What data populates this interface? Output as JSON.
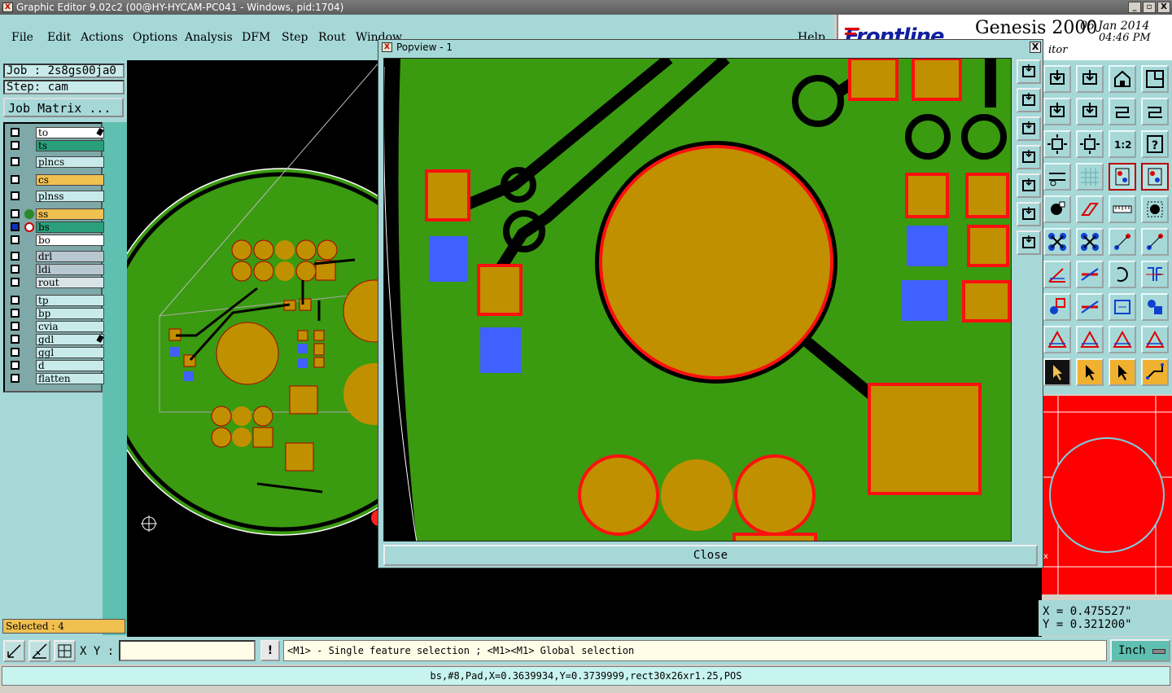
{
  "window": {
    "title": "Graphic Editor 9.02c2 (00@HY-HYCAM-PC041 - Windows, pid:1704)",
    "buttons": [
      "_",
      "▫",
      "X"
    ]
  },
  "menu": [
    "File",
    "Edit",
    "Actions",
    "Options",
    "Analysis",
    "DFM",
    "Step",
    "Rout",
    "Window",
    "Help"
  ],
  "logo": {
    "brand": "Frontline",
    "product": "Genesis 2000",
    "subtitle": "itor",
    "date": "06 Jan 2014",
    "time": "04:46 PM"
  },
  "job": {
    "job_label": "Job : 2s8gs00ja0",
    "step_label": "Step: cam",
    "matrix_button": "Job Matrix ..."
  },
  "layers": [
    {
      "name": "to",
      "color": "#ffffff",
      "flag": "pen"
    },
    {
      "name": "ts",
      "color": "#2aa07a"
    },
    {
      "name": "plncs",
      "color": "#c8eaea"
    },
    {
      "name": "cs",
      "color": "#f0c050"
    },
    {
      "name": "plnss",
      "color": "#c8eaea"
    },
    {
      "name": "ss",
      "color": "#f0c050",
      "flag": "green-dot"
    },
    {
      "name": "bs",
      "color": "#2aa07a",
      "flag": "work"
    },
    {
      "name": "bo",
      "color": "#ffffff"
    },
    {
      "name": "drl",
      "color": "#b8c8d0"
    },
    {
      "name": "ldi",
      "color": "#b8c8d0"
    },
    {
      "name": "rout",
      "color": "#d8e4e8"
    },
    {
      "name": "tp",
      "color": "#c8eaea"
    },
    {
      "name": "bp",
      "color": "#c8eaea"
    },
    {
      "name": "cvia",
      "color": "#c8eaea"
    },
    {
      "name": "gdl",
      "color": "#c8eaea",
      "flag": "pen"
    },
    {
      "name": "ggl",
      "color": "#c8eaea"
    },
    {
      "name": "d",
      "color": "#c8eaea"
    },
    {
      "name": "flatten",
      "color": "#c8eaea"
    }
  ],
  "selected": "Selected : 4",
  "popview": {
    "title": "Popview - 1",
    "close_x": "X",
    "close_button": "Close"
  },
  "coords": {
    "x": "X = 0.475527\"",
    "y": "Y = 0.321200\""
  },
  "bottom": {
    "xy_label": "X Y :",
    "xy_value": "",
    "bang": "!",
    "hint": "<M1> - Single feature selection ; <M1><M1> Global selection",
    "unit": "Inch"
  },
  "status": "bs,#8,Pad,X=0.3639934,Y=0.3739999,rect30x26xr1.25,POS",
  "colors": {
    "board": "#3a9a10",
    "pad": "#c09000",
    "outline": "#ff1010",
    "mask": "#4060ff",
    "teal": "#a6d8d8"
  },
  "tools": [
    "zoom-home-icon",
    "zoom-window-icon",
    "home-icon",
    "split-view-icon",
    "pan-left-icon",
    "pan-right-icon",
    "flip-icon",
    "snap-icon",
    "fit-icon",
    "center-icon",
    "ratio-1-2-icon",
    "help-icon",
    "measure-icon",
    "grid-icon",
    "layers-on-icon",
    "layers-off-icon",
    "feature-icon",
    "edit-shape-icon",
    "ruler-icon",
    "select-box-icon",
    "node-icon",
    "cross-icon",
    "arrow-node-icon",
    "arrow-node2-icon",
    "angle-icon",
    "line-icon",
    "rotate-icon",
    "mirror-icon",
    "pad-icon",
    "trace-icon",
    "resize-icon",
    "connect-icon",
    "triangle-icon",
    "triangle2-icon",
    "triangle3-icon",
    "triangle4-icon",
    "cursor-icon",
    "cursor-orange-icon",
    "cursor2-icon",
    "route-icon"
  ]
}
